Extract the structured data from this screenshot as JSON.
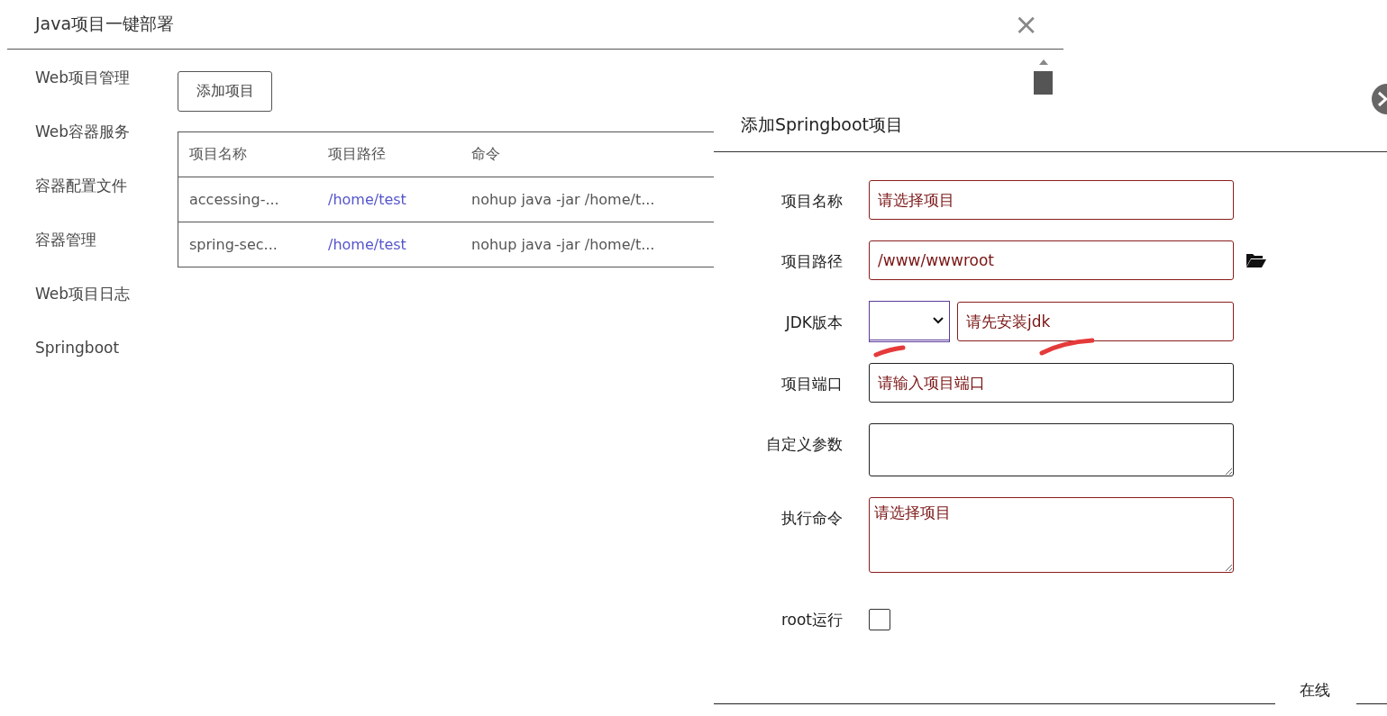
{
  "dialog": {
    "title": "Java项目一键部署",
    "close": "×"
  },
  "sidebar": {
    "items": [
      "Web项目管理",
      "Web容器服务",
      "容器配置文件",
      "容器管理",
      "Web项目日志",
      "Springboot"
    ]
  },
  "add_button": "添加项目",
  "table": {
    "columns": [
      "项目名称",
      "项目路径",
      "命令"
    ],
    "rows": [
      {
        "name": "accessing-...",
        "path": "/home/test",
        "command": "nohup java -jar /home/t..."
      },
      {
        "name": "spring-sec...",
        "path": "/home/test",
        "command": "nohup java -jar /home/t..."
      }
    ]
  },
  "form": {
    "title": "添加Springboot项目",
    "fields": [
      {
        "kind": "input",
        "label": "项目名称",
        "placeholder": "请选择项目",
        "invalid": true
      },
      {
        "kind": "path",
        "label": "项目路径",
        "value": "/www/wwwroot",
        "invalid": true
      },
      {
        "kind": "jdk",
        "label": "JDK版本",
        "placeholder": "请先安装jdk",
        "invalid": true
      },
      {
        "kind": "input",
        "label": "项目端口",
        "placeholder": "请输入项目端口",
        "invalid": false
      },
      {
        "kind": "textarea",
        "label": "自定义参数",
        "invalid": false
      },
      {
        "kind": "textarea",
        "label": "执行命令",
        "placeholder": "请选择项目",
        "invalid": true
      },
      {
        "kind": "checkbox",
        "label": "root运行",
        "checked": false
      }
    ]
  },
  "support": "在线"
}
